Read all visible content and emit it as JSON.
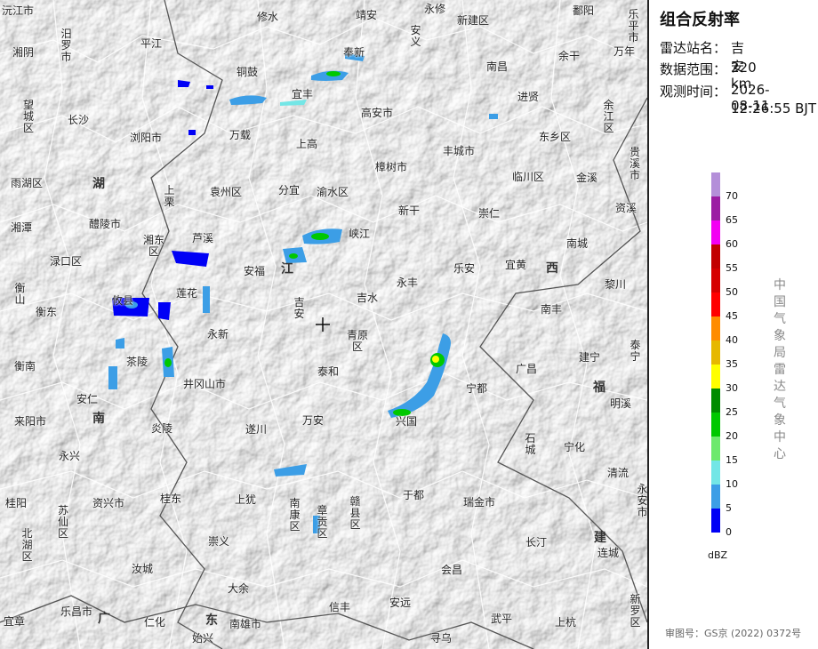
{
  "panel": {
    "title": "组合反射率",
    "station_label": "雷达站名：",
    "station": "吉安",
    "range_label": "数据范围：",
    "range": "220 km",
    "time_label": "观测时间：",
    "time_date": "2026-08-11",
    "time_clock": "12:26:55 BJT",
    "org": "中国气象局雷达气象中心",
    "review": "审图号：GS京 (2022) 0372号"
  },
  "legend": {
    "unit": "dBZ",
    "colors": [
      "#b48fd9",
      "#9b1da3",
      "#f300f3",
      "#c20000",
      "#d60000",
      "#ff0000",
      "#ff8c00",
      "#e6b800",
      "#ffff00",
      "#008c00",
      "#00c800",
      "#6de96d",
      "#73e6e6",
      "#3c9ee6",
      "#0000f5"
    ],
    "ticks": [
      "70",
      "65",
      "60",
      "55",
      "50",
      "45",
      "40",
      "35",
      "30",
      "25",
      "20",
      "15",
      "10",
      "5",
      "0"
    ]
  },
  "places": [
    {
      "name": "沅江市"
    },
    {
      "name": "修水"
    },
    {
      "name": "靖安"
    },
    {
      "name": "永修"
    },
    {
      "name": "新建区"
    },
    {
      "name": "鄱阳"
    },
    {
      "name": "乐平市"
    },
    {
      "name": "湘阴"
    },
    {
      "name": "汨罗市"
    },
    {
      "name": "平江"
    },
    {
      "name": "安义"
    },
    {
      "name": "奉新"
    },
    {
      "name": "南昌"
    },
    {
      "name": "余干"
    },
    {
      "name": "万年"
    },
    {
      "name": "铜鼓"
    },
    {
      "name": "宜丰"
    },
    {
      "name": "进贤"
    },
    {
      "name": "望城区"
    },
    {
      "name": "长沙"
    },
    {
      "name": "高安市"
    },
    {
      "name": "余江区"
    },
    {
      "name": "浏阳市"
    },
    {
      "name": "万载"
    },
    {
      "name": "东乡区"
    },
    {
      "name": "贵溪市"
    },
    {
      "name": "上高"
    },
    {
      "name": "丰城市"
    },
    {
      "name": "樟树市"
    },
    {
      "name": "雨湖区"
    },
    {
      "name": "湖"
    },
    {
      "name": "上栗"
    },
    {
      "name": "袁州区"
    },
    {
      "name": "分宜"
    },
    {
      "name": "渝水区"
    },
    {
      "name": "临川区"
    },
    {
      "name": "金溪"
    },
    {
      "name": "新干"
    },
    {
      "name": "崇仁"
    },
    {
      "name": "资溪"
    },
    {
      "name": "湘潭"
    },
    {
      "name": "醴陵市"
    },
    {
      "name": "芦溪"
    },
    {
      "name": "峡江"
    },
    {
      "name": "南城"
    },
    {
      "name": "湘东区"
    },
    {
      "name": "渌口区"
    },
    {
      "name": "安福"
    },
    {
      "name": "江"
    },
    {
      "name": "乐安"
    },
    {
      "name": "宜黄"
    },
    {
      "name": "西"
    },
    {
      "name": "衡山"
    },
    {
      "name": "永丰"
    },
    {
      "name": "黎川"
    },
    {
      "name": "莲花"
    },
    {
      "name": "吉水"
    },
    {
      "name": "攸县"
    },
    {
      "name": "衡东"
    },
    {
      "name": "吉安"
    },
    {
      "name": "南丰"
    },
    {
      "name": "永新"
    },
    {
      "name": "青原区"
    },
    {
      "name": "泰宁"
    },
    {
      "name": "建宁"
    },
    {
      "name": "衡南"
    },
    {
      "name": "茶陵"
    },
    {
      "name": "泰和"
    },
    {
      "name": "广昌"
    },
    {
      "name": "宁都"
    },
    {
      "name": "福"
    },
    {
      "name": "井冈山市"
    },
    {
      "name": "安仁"
    },
    {
      "name": "明溪"
    },
    {
      "name": "南"
    },
    {
      "name": "来阳市"
    },
    {
      "name": "万安"
    },
    {
      "name": "兴国"
    },
    {
      "name": "炎陵"
    },
    {
      "name": "遂川"
    },
    {
      "name": "石城"
    },
    {
      "name": "宁化"
    },
    {
      "name": "永兴"
    },
    {
      "name": "清流"
    },
    {
      "name": "桂阳"
    },
    {
      "name": "资兴市"
    },
    {
      "name": "于都"
    },
    {
      "name": "瑞金市"
    },
    {
      "name": "苏仙区"
    },
    {
      "name": "桂东"
    },
    {
      "name": "上犹"
    },
    {
      "name": "南康区"
    },
    {
      "name": "章贡区"
    },
    {
      "name": "赣县区"
    },
    {
      "name": "永安市"
    },
    {
      "name": "北湖区"
    },
    {
      "name": "建"
    },
    {
      "name": "崇义"
    },
    {
      "name": "长汀"
    },
    {
      "name": "连城"
    },
    {
      "name": "会昌"
    },
    {
      "name": "汝城"
    },
    {
      "name": "大余"
    },
    {
      "name": "乐昌市"
    },
    {
      "name": "广"
    },
    {
      "name": "东"
    },
    {
      "name": "信丰"
    },
    {
      "name": "安远"
    },
    {
      "name": "宜章"
    },
    {
      "name": "仁化"
    },
    {
      "name": "南雄市"
    },
    {
      "name": "武平"
    },
    {
      "name": "上杭"
    },
    {
      "name": "新罗区"
    },
    {
      "name": "始兴"
    },
    {
      "name": "寻乌"
    }
  ]
}
